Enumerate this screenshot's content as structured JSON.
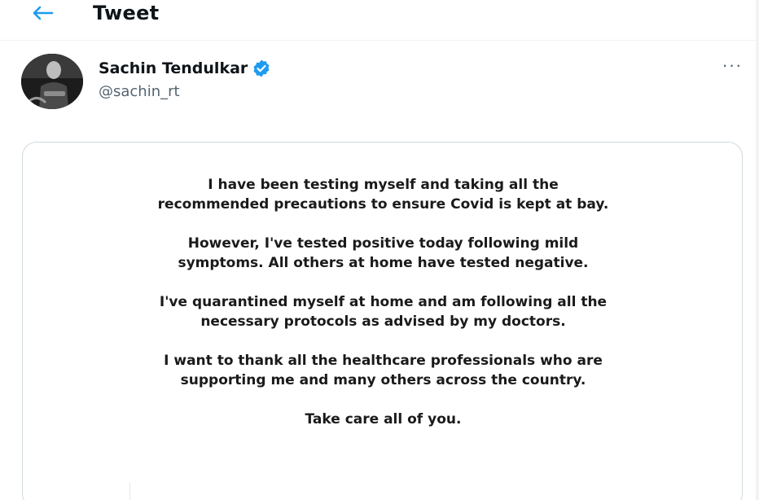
{
  "header": {
    "back_icon": "arrow-left-icon",
    "title": "Tweet"
  },
  "author": {
    "display_name": "Sachin Tendulkar",
    "handle": "@sachin_rt",
    "verified_icon": "verified-badge-icon",
    "more_icon": "more-horizontal-icon",
    "more_label": "···"
  },
  "image_card": {
    "paragraphs": [
      "I have been testing myself and taking all the recommended precautions to ensure Covid is kept at bay.",
      "However, I've tested positive today following mild symptoms. All others at home have tested negative.",
      "I've quarantined myself at home and am following all the necessary protocols as advised by my doctors.",
      "I want to thank all the healthcare professionals who are supporting me and many others across the country.",
      "Take care all of you."
    ]
  },
  "colors": {
    "accent": "#1d9bf0",
    "text": "#0f1419",
    "secondary": "#536471",
    "border": "#cfd9de"
  }
}
